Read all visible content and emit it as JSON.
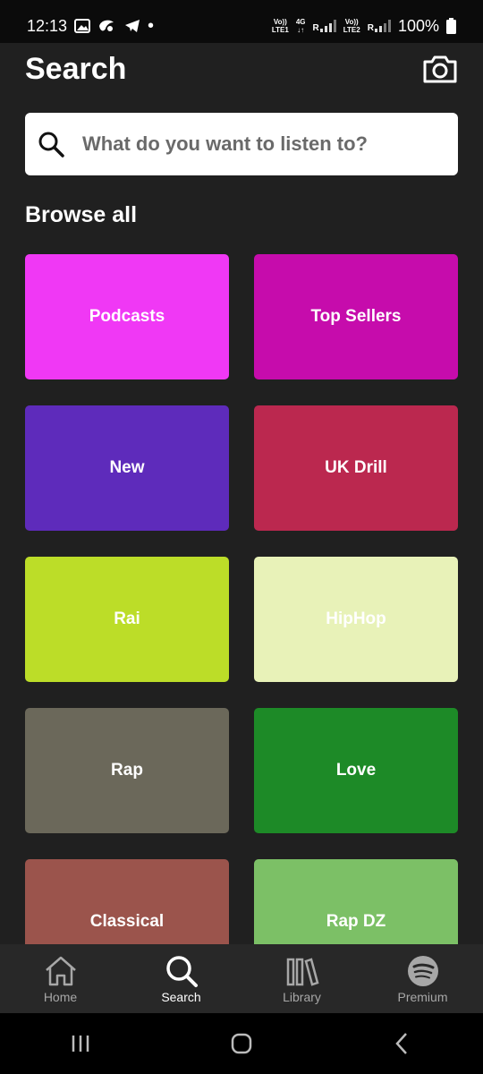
{
  "status": {
    "time": "12:13",
    "battery": "100%",
    "sim1_top": "Vo))",
    "sim1_bottom": "LTE1",
    "net_type": "4G",
    "roam1": "R",
    "sim2_top": "Vo))",
    "sim2_bottom": "LTE2",
    "roam2": "R"
  },
  "header": {
    "title": "Search"
  },
  "search": {
    "placeholder": "What do you want to listen to?"
  },
  "browse": {
    "title": "Browse all",
    "tiles": [
      {
        "label": "Podcasts",
        "color": "#f038f5"
      },
      {
        "label": "Top Sellers",
        "color": "#c60cac"
      },
      {
        "label": "New",
        "color": "#5e2bbb"
      },
      {
        "label": "UK Drill",
        "color": "#bb284f"
      },
      {
        "label": "Rai",
        "color": "#bcdd28"
      },
      {
        "label": "HipHop",
        "color": "#e8f2b8"
      },
      {
        "label": "Rap",
        "color": "#6b685a"
      },
      {
        "label": "Love",
        "color": "#1d8a27"
      },
      {
        "label": "Classical",
        "color": "#9b544c"
      },
      {
        "label": "Rap DZ",
        "color": "#7cc066"
      }
    ]
  },
  "nav": {
    "home": "Home",
    "search": "Search",
    "library": "Library",
    "premium": "Premium"
  }
}
